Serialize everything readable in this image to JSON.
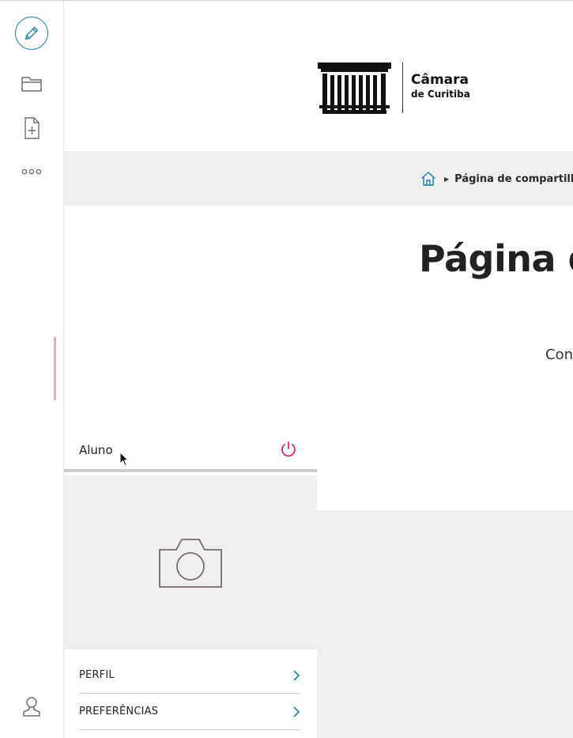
{
  "header": {
    "logo_name": "Câmara",
    "logo_sub": "de Curitiba"
  },
  "breadcrumb": {
    "current": "Página de compartilhamento"
  },
  "main": {
    "title": "Página de compartilhamento",
    "subtitle": "Con"
  },
  "user_panel": {
    "name": "Aluno",
    "menu": [
      {
        "label": "PERFIL"
      },
      {
        "label": "PREFERÊNCIAS"
      }
    ]
  },
  "rail": {
    "icons": [
      "pencil-icon",
      "folder-icon",
      "new-document-icon",
      "more-icon",
      "user-icon"
    ]
  },
  "colors": {
    "accent_blue": "#1a7fa6",
    "power_pink": "#d4145a",
    "pink_bar": "#f0a7c8",
    "icon_brown": "#7a6a6a",
    "bar_gray": "#efefef"
  }
}
